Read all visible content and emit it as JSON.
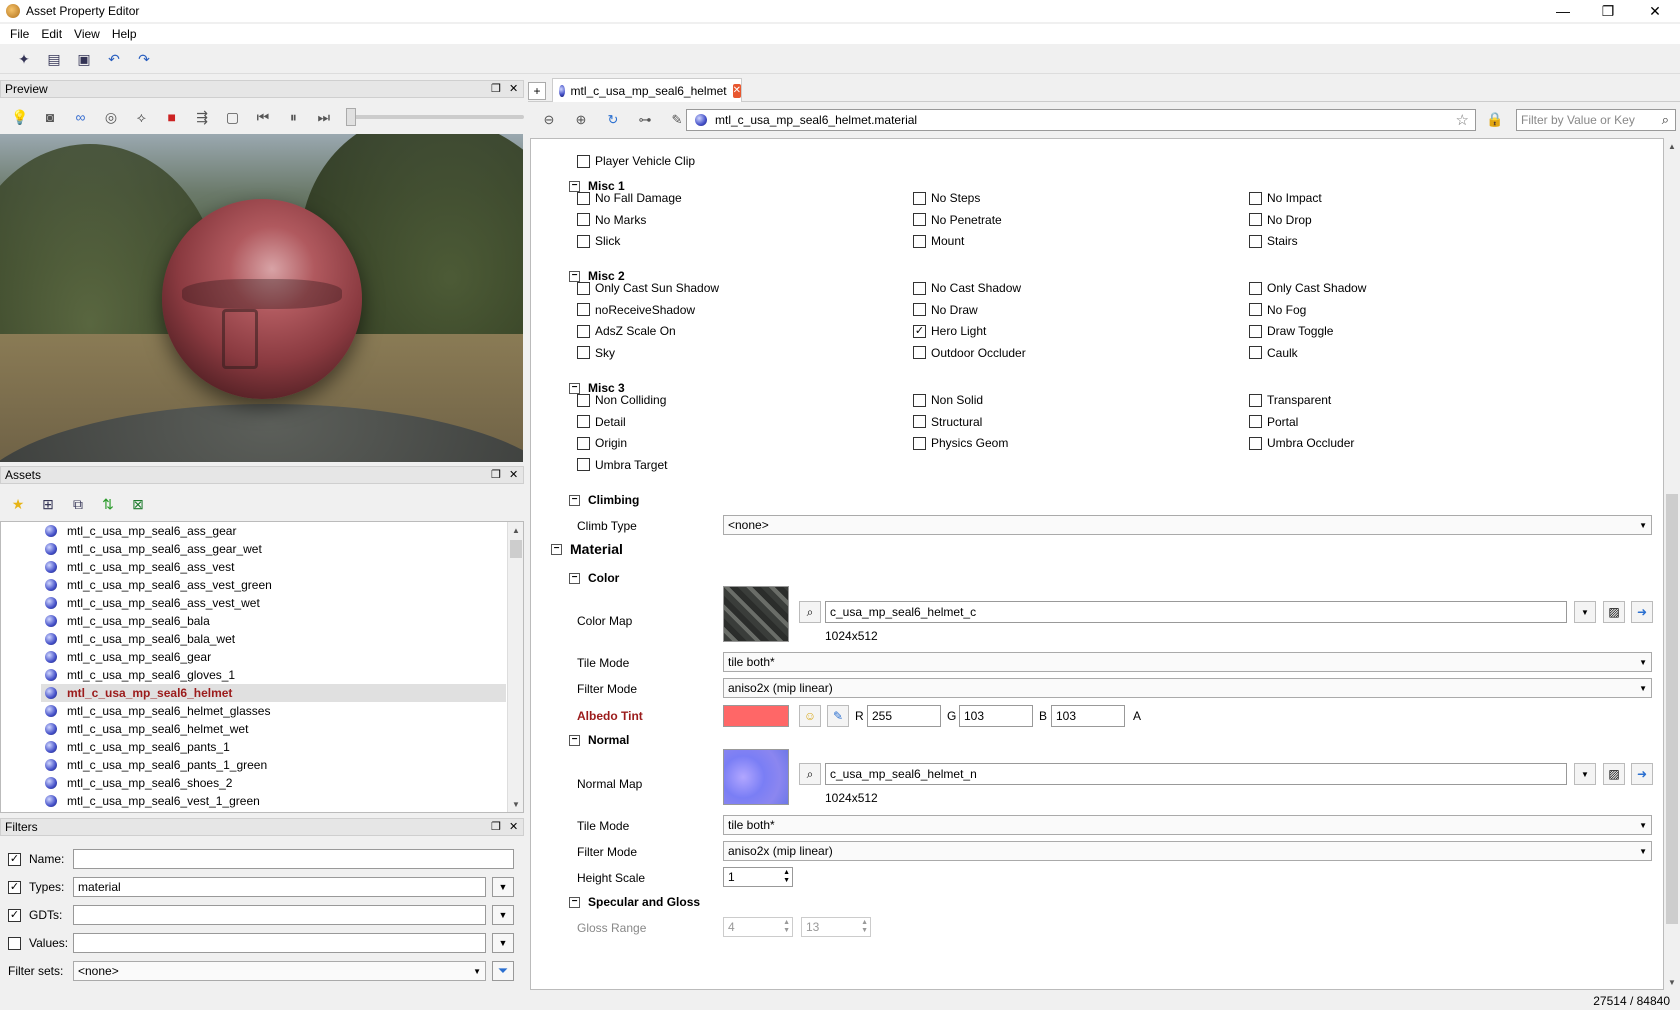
{
  "window": {
    "title": "Asset Property Editor",
    "minimize": "—",
    "restore": "❐",
    "close": "✕"
  },
  "menu": [
    "File",
    "Edit",
    "View",
    "Help"
  ],
  "panes": {
    "preview": "Preview",
    "assets": "Assets",
    "filters": "Filters"
  },
  "assets": {
    "items": [
      "mtl_c_usa_mp_seal6_ass_gear",
      "mtl_c_usa_mp_seal6_ass_gear_wet",
      "mtl_c_usa_mp_seal6_ass_vest",
      "mtl_c_usa_mp_seal6_ass_vest_green",
      "mtl_c_usa_mp_seal6_ass_vest_wet",
      "mtl_c_usa_mp_seal6_bala",
      "mtl_c_usa_mp_seal6_bala_wet",
      "mtl_c_usa_mp_seal6_gear",
      "mtl_c_usa_mp_seal6_gloves_1",
      "mtl_c_usa_mp_seal6_helmet",
      "mtl_c_usa_mp_seal6_helmet_glasses",
      "mtl_c_usa_mp_seal6_helmet_wet",
      "mtl_c_usa_mp_seal6_pants_1",
      "mtl_c_usa_mp_seal6_pants_1_green",
      "mtl_c_usa_mp_seal6_shoes_2",
      "mtl_c_usa_mp_seal6_vest_1_green"
    ],
    "selected_index": 9
  },
  "filters": {
    "name_label": "Name:",
    "name_value": "",
    "name_checked": true,
    "types_label": "Types:",
    "types_value": "material",
    "types_checked": true,
    "gdts_label": "GDTs:",
    "gdts_value": "",
    "gdts_checked": true,
    "values_label": "Values:",
    "values_value": "",
    "values_checked": false,
    "filtersets_label": "Filter sets:",
    "filtersets_value": "<none>"
  },
  "tab": {
    "label": "mtl_c_usa_mp_seal6_helmet",
    "plus": "+"
  },
  "nav": {
    "path": "mtl_c_usa_mp_seal6_helmet.material",
    "filter_placeholder": "Filter by Value or Key"
  },
  "props": {
    "player_vehicle_clip": "Player Vehicle Clip",
    "misc1": {
      "title": "Misc 1",
      "items": [
        {
          "label": "No Fall Damage",
          "checked": false
        },
        {
          "label": "No Steps",
          "checked": false
        },
        {
          "label": "No Impact",
          "checked": false
        },
        {
          "label": "No Marks",
          "checked": false
        },
        {
          "label": "No Penetrate",
          "checked": false
        },
        {
          "label": "No Drop",
          "checked": false
        },
        {
          "label": "Slick",
          "checked": false
        },
        {
          "label": "Mount",
          "checked": false
        },
        {
          "label": "Stairs",
          "checked": false
        }
      ]
    },
    "misc2": {
      "title": "Misc 2",
      "items": [
        {
          "label": "Only Cast Sun Shadow",
          "checked": false
        },
        {
          "label": "No Cast Shadow",
          "checked": false
        },
        {
          "label": "Only Cast Shadow",
          "checked": false
        },
        {
          "label": "noReceiveShadow",
          "checked": false
        },
        {
          "label": "No Draw",
          "checked": false
        },
        {
          "label": "No Fog",
          "checked": false
        },
        {
          "label": "AdsZ Scale On",
          "checked": false
        },
        {
          "label": "Hero Light",
          "checked": true
        },
        {
          "label": "Draw Toggle",
          "checked": false
        },
        {
          "label": "Sky",
          "checked": false
        },
        {
          "label": "Outdoor Occluder",
          "checked": false
        },
        {
          "label": "Caulk",
          "checked": false
        }
      ]
    },
    "misc3": {
      "title": "Misc 3",
      "items": [
        {
          "label": "Non Colliding",
          "checked": false
        },
        {
          "label": "Non Solid",
          "checked": false
        },
        {
          "label": "Transparent",
          "checked": false
        },
        {
          "label": "Detail",
          "checked": false
        },
        {
          "label": "Structural",
          "checked": false
        },
        {
          "label": "Portal",
          "checked": false
        },
        {
          "label": "Origin",
          "checked": false
        },
        {
          "label": "Physics Geom",
          "checked": false
        },
        {
          "label": "Umbra Occluder",
          "checked": false
        },
        {
          "label": "Umbra Target",
          "checked": false
        }
      ]
    },
    "climbing": {
      "title": "Climbing",
      "climb_type_label": "Climb Type",
      "climb_type_value": "<none>"
    },
    "material_title": "Material",
    "color": {
      "title": "Color",
      "map_label": "Color Map",
      "map_value": "c_usa_mp_seal6_helmet_c",
      "map_size": "1024x512",
      "tile_label": "Tile Mode",
      "tile_value": "tile both*",
      "filter_label": "Filter Mode",
      "filter_value": "aniso2x (mip linear)",
      "albedo_label": "Albedo Tint",
      "albedo_color": "#ff6767",
      "r_label": "R",
      "r": "255",
      "g_label": "G",
      "g": "103",
      "b_label": "B",
      "b": "103",
      "a_label": "A"
    },
    "normal": {
      "title": "Normal",
      "map_label": "Normal Map",
      "map_value": "c_usa_mp_seal6_helmet_n",
      "map_size": "1024x512",
      "tile_label": "Tile Mode",
      "tile_value": "tile both*",
      "filter_label": "Filter Mode",
      "filter_value": "aniso2x (mip linear)",
      "height_label": "Height Scale",
      "height_value": "1"
    },
    "specular": {
      "title": "Specular and Gloss",
      "gloss_label": "Gloss Range",
      "gloss_min": "4",
      "gloss_max": "13"
    }
  },
  "status": {
    "count": "27514 / 84840"
  }
}
